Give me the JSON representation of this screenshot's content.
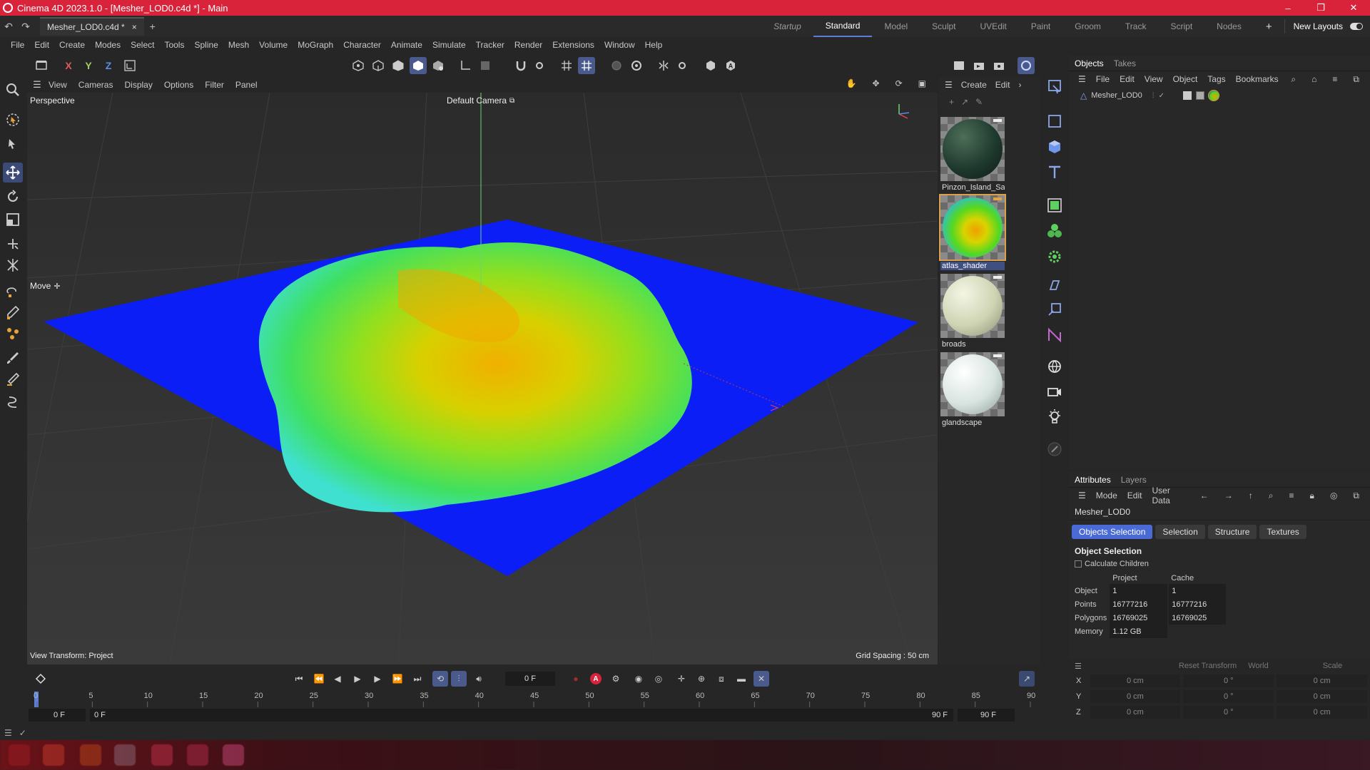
{
  "window": {
    "title": "Cinema 4D 2023.1.0 - [Mesher_LOD0.c4d *] - Main",
    "controls": [
      "–",
      "❐",
      "✕"
    ]
  },
  "file_tab": {
    "name": "Mesher_LOD0.c4d *",
    "close": "×",
    "add": "+"
  },
  "layouts": {
    "tabs": [
      "Startup",
      "Standard",
      "Model",
      "Sculpt",
      "UVEdit",
      "Paint",
      "Groom",
      "Track",
      "Script",
      "Nodes"
    ],
    "active": "Standard",
    "add": "+",
    "new_layouts": "New Layouts"
  },
  "menu": [
    "File",
    "Edit",
    "Create",
    "Modes",
    "Select",
    "Tools",
    "Spline",
    "Mesh",
    "Volume",
    "MoGraph",
    "Character",
    "Animate",
    "Simulate",
    "Tracker",
    "Render",
    "Extensions",
    "Window",
    "Help"
  ],
  "axis_buttons": {
    "x": "X",
    "y": "Y",
    "z": "Z"
  },
  "viewport": {
    "menu": [
      "View",
      "Cameras",
      "Display",
      "Options",
      "Filter",
      "Panel"
    ],
    "projection": "Perspective",
    "camera": "Default Camera",
    "camera_icon": "camera-link-icon",
    "tool_label": "Move",
    "view_transform": "View Transform: Project",
    "grid_spacing": "Grid Spacing : 50 cm",
    "colors": {
      "water": "#0a1ef5",
      "land_low": "#3fe0d0",
      "land_mid": "#7bdc1f",
      "land_high": "#f0b000"
    }
  },
  "materials": {
    "menu": [
      "Create",
      "Edit"
    ],
    "items": [
      {
        "name": "Pinzon_Island_Sat",
        "selected": false,
        "style": "sat"
      },
      {
        "name": "atlas_shader",
        "selected": true,
        "style": "atlas"
      },
      {
        "name": "broads",
        "selected": false,
        "style": "broads"
      },
      {
        "name": "glandscape",
        "selected": false,
        "style": "glandscape"
      }
    ]
  },
  "objects_panel": {
    "tabs": [
      "Objects",
      "Takes"
    ],
    "active": "Objects",
    "menu": [
      "File",
      "Edit",
      "View",
      "Object",
      "Tags",
      "Bookmarks"
    ],
    "object_name": "Mesher_LOD0"
  },
  "attributes_panel": {
    "tabs": [
      "Attributes",
      "Layers"
    ],
    "active": "Attributes",
    "menu": [
      "Mode",
      "Edit",
      "User Data"
    ],
    "object_name": "Mesher_LOD0",
    "subtabs": [
      "Objects Selection",
      "Selection",
      "Structure",
      "Textures"
    ],
    "active_subtab": "Objects Selection",
    "section": "Object Selection",
    "checkbox": "Calculate Children",
    "columns": [
      "Project",
      "Cache"
    ],
    "rows": [
      {
        "label": "Object",
        "project": "1",
        "cache": "1"
      },
      {
        "label": "Points",
        "project": "16777216",
        "cache": "16777216"
      },
      {
        "label": "Polygons",
        "project": "16769025",
        "cache": "16769025"
      },
      {
        "label": "Memory",
        "project": "1.12 GB",
        "cache": ""
      }
    ]
  },
  "coordinates": {
    "header": [
      "Reset Transform",
      "World",
      "Scale"
    ],
    "rows": [
      {
        "axis": "X",
        "pos": "0 cm",
        "rot": "0 °",
        "scale": "0 cm"
      },
      {
        "axis": "Y",
        "pos": "0 cm",
        "rot": "0 °",
        "scale": "0 cm"
      },
      {
        "axis": "Z",
        "pos": "0 cm",
        "rot": "0 °",
        "scale": "0 cm"
      }
    ]
  },
  "timeline": {
    "current_frame": "0 F",
    "ticks": [
      "0",
      "5",
      "10",
      "15",
      "20",
      "25",
      "30",
      "35",
      "40",
      "45",
      "50",
      "55",
      "60",
      "65",
      "70",
      "75",
      "80",
      "85",
      "90"
    ],
    "start": "0 F",
    "preview_start": "0 F",
    "preview_end": "90 F",
    "end": "90 F"
  }
}
